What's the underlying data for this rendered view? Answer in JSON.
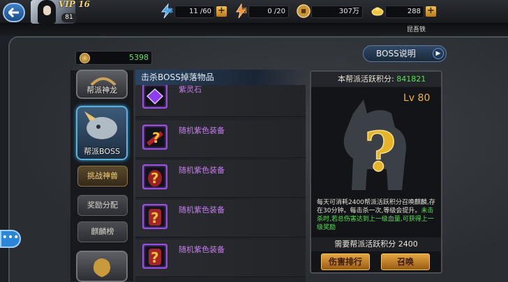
{
  "player": {
    "vip": "VIP 16",
    "level": "81",
    "name": "昆吾铁"
  },
  "resources": {
    "stamina": {
      "label": "体",
      "value": "11 /60"
    },
    "vitality": {
      "label": "活",
      "value": "0 /20"
    },
    "coins": {
      "value": "307万"
    },
    "gold": {
      "value": "288"
    }
  },
  "guild": {
    "score": "5398",
    "boss_info_button": "BOSS说明"
  },
  "sidebar": {
    "items": [
      {
        "label": "帮派神龙"
      },
      {
        "label": "帮派BOSS"
      },
      {
        "label": "挑战神兽"
      },
      {
        "label": "奖励分配"
      },
      {
        "label": "麒麟榜"
      }
    ]
  },
  "drops": {
    "title": "击杀BOSS掉落物品",
    "items": [
      {
        "name": "紫灵石"
      },
      {
        "name": "随机紫色装备"
      },
      {
        "name": "随机紫色装备"
      },
      {
        "name": "随机紫色装备"
      },
      {
        "name": "随机紫色装备"
      }
    ]
  },
  "boss_panel": {
    "activity_label": "本帮派活跃积分:",
    "activity_value": "841821",
    "level": "Lv 80",
    "desc_main": "每天可消耗2400帮派活跃积分召唤麒麟,存在30分钟。每击杀一次,等级会提升。",
    "desc_green": "未击杀时,若总伤害达到上一级血量,可获得上一级奖励",
    "need": "需要帮派活跃积分 2400",
    "rank_button": "伤害排行",
    "summon_button": "召唤"
  },
  "colors": {
    "accent_green": "#4fe84b",
    "item_purple": "#c97bf3",
    "lv_orange": "#f0b23e"
  }
}
